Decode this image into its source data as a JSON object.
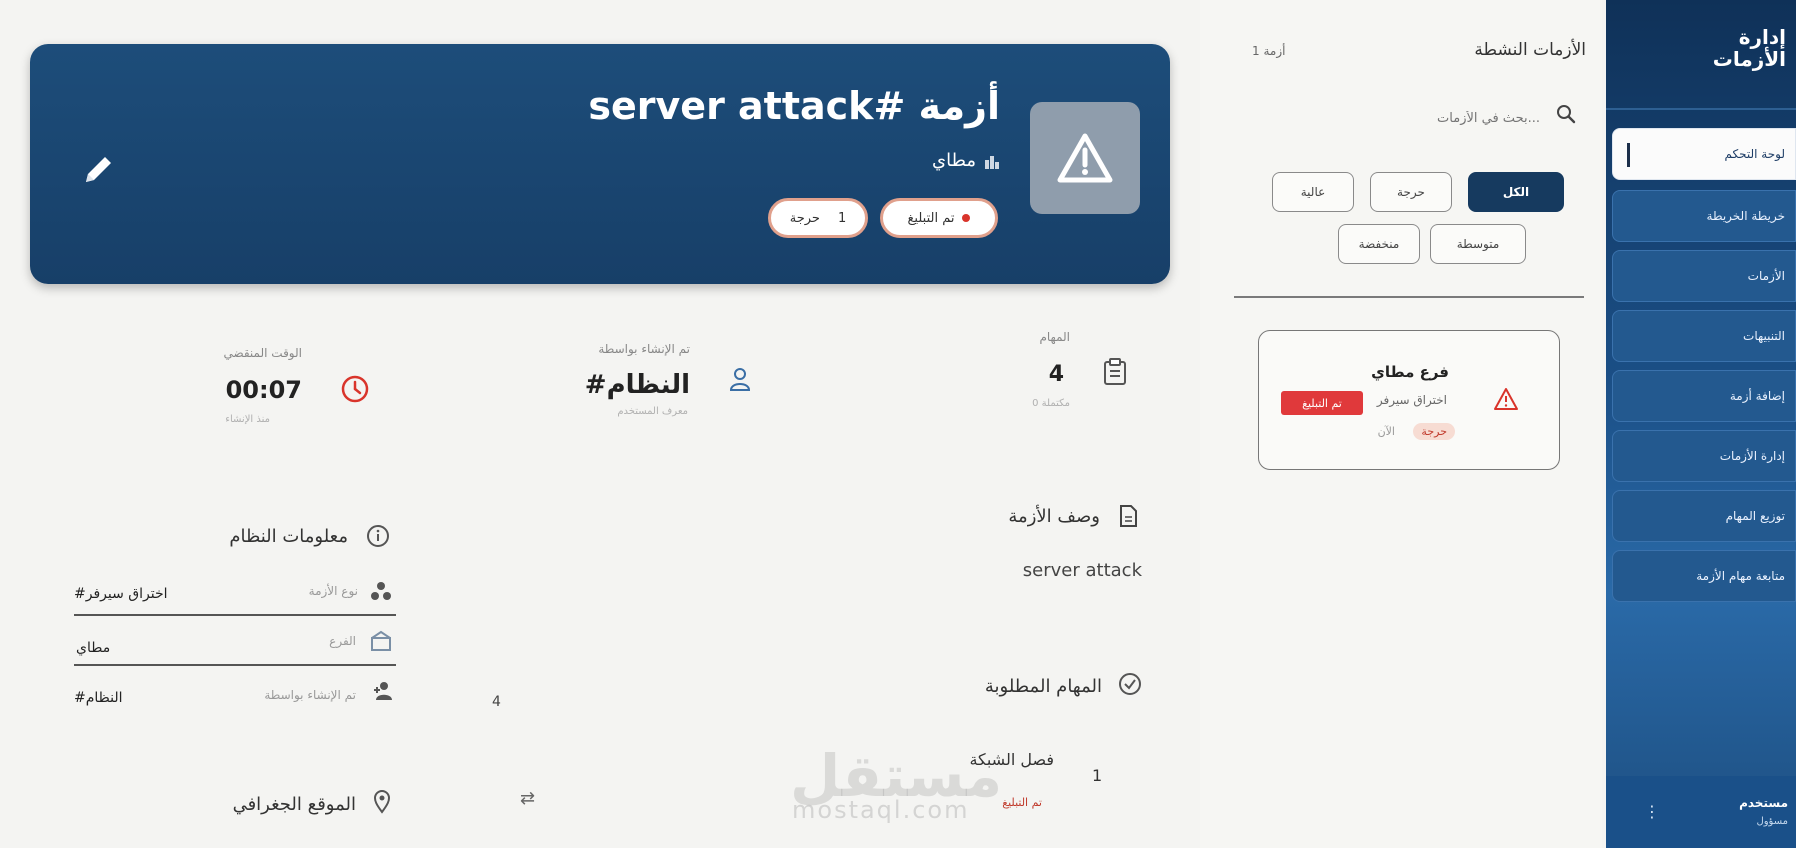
{
  "sidebar": {
    "title_line1": "إدارة",
    "title_line2": "الأزمات",
    "items": [
      {
        "label": "لوحة التحكم"
      },
      {
        "label": "خريطة الخريطة"
      },
      {
        "label": "الأزمات"
      },
      {
        "label": "التنبيهات"
      },
      {
        "label": "إضافة أزمة"
      },
      {
        "label": "إدارة الأزمات"
      },
      {
        "label": "توزيع المهام"
      },
      {
        "label": "متابعة مهام الأزمة"
      }
    ],
    "footer_name": "مستخدم",
    "footer_role": "مسؤول",
    "footer_menu_icon": "more-vertical-icon"
  },
  "crisis_list": {
    "title": "الأزمات النشطة",
    "count": "1 أزمة",
    "search_placeholder": "بحث في الأزمات...",
    "filters": [
      {
        "label": "الكل",
        "active": true
      },
      {
        "label": "حرجة",
        "active": false
      },
      {
        "label": "عالية",
        "active": false
      },
      {
        "label": "متوسطة",
        "active": false
      },
      {
        "label": "منخفضة",
        "active": false
      }
    ],
    "cards": [
      {
        "branch": "فرع مطاي",
        "type": "اختراق سيرفر",
        "status": "تم التبليغ",
        "severity": "حرجة",
        "time": "الآن"
      }
    ]
  },
  "crisis": {
    "title": "أزمة #server attack",
    "branch": "مطاي",
    "status_pill": "تم التبليغ",
    "severity_pill": "حرجة",
    "severity_count": "1",
    "icon": "warning-icon",
    "edit_icon": "pencil-icon"
  },
  "stats": {
    "tasks_label": "المهام",
    "tasks_value": "4",
    "tasks_sub": "0 مكتملة",
    "created_by_label": "تم الإنشاء بواسطة",
    "created_by_value": "#النظام",
    "created_by_sub": "معرف المستخدم",
    "elapsed_label": "الوقت المنقضي",
    "elapsed_value": "00:07",
    "elapsed_sub": "منذ الإنشاء"
  },
  "description": {
    "title": "وصف الأزمة",
    "text": "server attack"
  },
  "required_tasks": {
    "title": "المهام المطلوبة",
    "count": "4",
    "items": [
      {
        "number": "1",
        "title": "فصل الشبكة",
        "status": "تم التبليغ"
      }
    ]
  },
  "system_info": {
    "title": "معلومات النظام",
    "rows": [
      {
        "label": "نوع الأزمة",
        "value": "#اختراق سيرفر"
      },
      {
        "label": "الفرع",
        "value": "مطاي"
      },
      {
        "label": "تم الإنشاء بواسطة",
        "value": "#النظام"
      }
    ]
  },
  "location": {
    "title": "الموقع الجغرافي"
  },
  "watermark": {
    "arabic": "مستقل",
    "latin": "mostaql.com"
  },
  "colors": {
    "header_bg": "#1d4d7a",
    "sidebar_bg": "#0f3158",
    "active_filter": "#163a5f",
    "danger": "#e0393b"
  }
}
